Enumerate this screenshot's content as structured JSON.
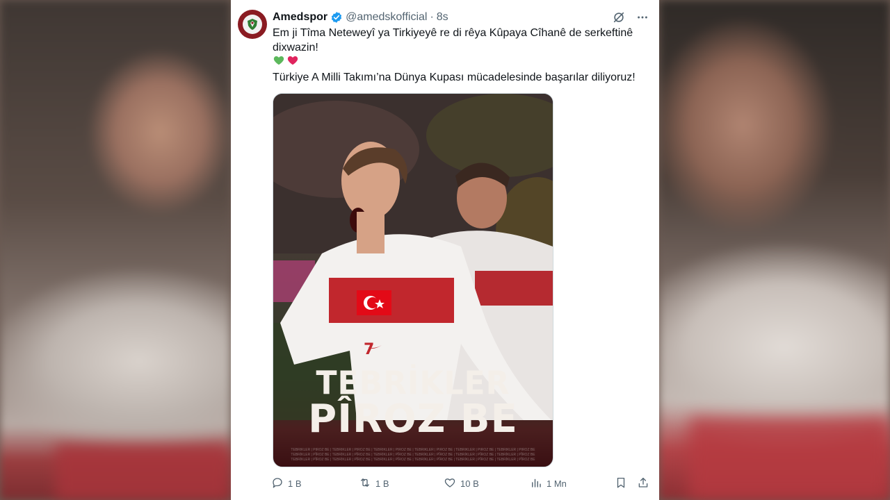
{
  "post": {
    "display_name": "Amedspor",
    "handle": "@amedskofficial",
    "separator": "·",
    "time": "8s",
    "line1": "Em ji Tîma Neteweyî ya Tirkiyeyê re di rêya Kûpaya Cîhanê de serkeftinê dixwazin!",
    "line2": "Türkiye A Milli Takımı’na Dünya Kupası mücadelesinde başarılar diliyoruz!",
    "emojis": [
      "green-heart",
      "red-heart"
    ]
  },
  "media": {
    "headline1": "TEBRİKLER",
    "headline2": "PÎROZ BE",
    "shirt_number": "7",
    "strip_text": "TEBRİKLER | PÎROZ BE | TEBRİKLER | PÎROZ BE | TEBRİKLER | PÎROZ BE | TEBRİKLER | PÎROZ BE | TEBRİKLER | PÎROZ BE | TEBRİKLER | PÎROZ BE"
  },
  "actions": {
    "replies": "1 B",
    "reposts": "1 B",
    "likes": "10 B",
    "views": "1 Mn"
  },
  "colors": {
    "verified": "#1d9bf0",
    "text": "#0f1419",
    "muted": "#536471",
    "brand_red": "#8a1b22",
    "green_heart": "#5cb85c",
    "red_heart": "#e0245e"
  }
}
